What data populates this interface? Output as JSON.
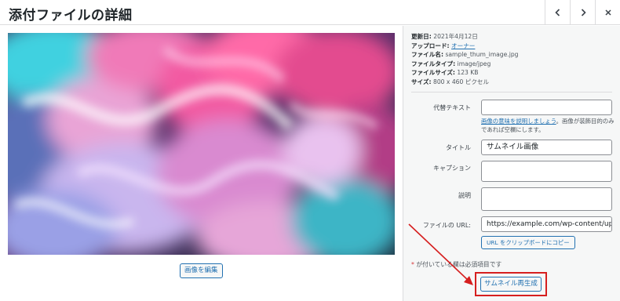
{
  "header": {
    "title": "添付ファイルの詳細",
    "prev_icon": "chevron-left-icon",
    "next_icon": "chevron-right-icon",
    "close_icon": "close-icon"
  },
  "preview": {
    "edit_image_label": "画像を編集"
  },
  "details": {
    "uploaded_on_label": "更新日:",
    "uploaded_on_value": "2021年4月12日",
    "uploaded_by_label": "アップロード:",
    "uploaded_by_value": "オーナー",
    "file_name_label": "ファイル名:",
    "file_name_value": "sample_thum_image.jpg",
    "file_type_label": "ファイルタイプ:",
    "file_type_value": "image/jpeg",
    "file_size_label": "ファイルサイズ:",
    "file_size_value": "123 KB",
    "dimensions_label": "サイズ:",
    "dimensions_value": "800 x 460 ピクセル"
  },
  "form": {
    "alt_label": "代替テキスト",
    "alt_value": "",
    "alt_help_link": "画像の意味を説明しましょう",
    "alt_help_text": "。画像が装飾目的のみであれば空欄にします。",
    "title_label": "タイトル",
    "title_value": "サムネイル画像",
    "caption_label": "キャプション",
    "caption_value": "",
    "description_label": "説明",
    "description_value": "",
    "file_url_label": "ファイルの URL:",
    "file_url_value": "https://example.com/wp-content/uploa",
    "copy_url_label": "URL をクリップボードにコピー",
    "required_note_star": "*",
    "required_note_text": " が付いている欄は必須項目です",
    "regenerate_label": "サムネイル再生成"
  },
  "colors": {
    "link": "#2271b1",
    "highlight": "#d61f1f",
    "sidebar_bg": "#f6f7f7",
    "border": "#dcdcde"
  }
}
